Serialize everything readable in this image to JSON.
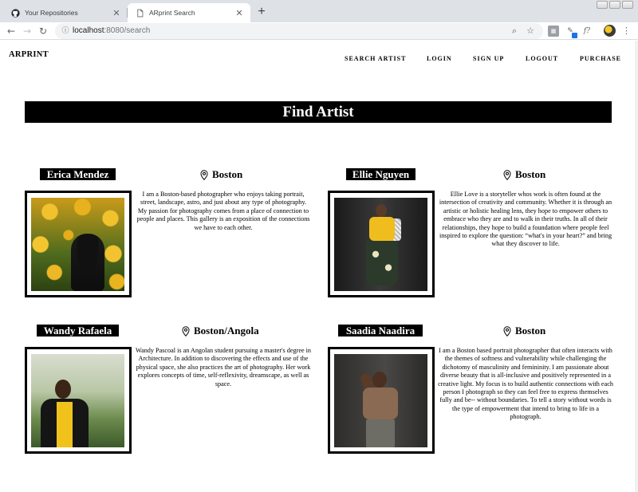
{
  "browser": {
    "tabs": [
      {
        "title": "Your Repositories",
        "active": false,
        "icon": "github-icon"
      },
      {
        "title": "ARprint Search",
        "active": true,
        "icon": "page-icon"
      }
    ],
    "url_host": "localhost",
    "url_path": ":8080/search"
  },
  "site": {
    "brand": "ARPRINT",
    "nav": [
      "SEARCH ARTIST",
      "LOGIN",
      "SIGN UP",
      "LOGOUT",
      "PURCHASE"
    ]
  },
  "page": {
    "title": "Find Artist"
  },
  "artists": [
    {
      "name": "Erica Mendez",
      "location": "Boston",
      "bio": "I am a Boston-based photographer who enjoys taking portrait, street, landscape, astro, and just about any type of photography. My passion for photography comes from a place of connection to people and places. This gallery is an exposition of the connections we have to each other."
    },
    {
      "name": "Ellie Nguyen",
      "location": "Boston",
      "bio": "Ellie Love is a storyteller whos work is often found at the intersection of creativity and community. Whether it is through an artistic or holistic healing lens, they hope to empower others to embrace who they are and to walk in their truths. In all of their relationships, they hope to build a foundation where people feel inspired to explore the question: “what's in your heart?” and bring what they discover to life."
    },
    {
      "name": "Wandy Rafaela",
      "location": "Boston/Angola",
      "bio": "Wandy Pascoal is an Angolan student pursuing a master's degree in Architecture. In addition to discovering the effects and use of the physical space, she also practices the art of photography. Her work explores concepts of time, self-reflexivity, dreamscape, as well as space."
    },
    {
      "name": "Saadia Naadira",
      "location": "Boston",
      "bio": "I am a Boston based portrait photographer that often interacts with the themes of softness and vulnerability while challenging the dichotomy of masculinity and femininity. I am passionate about diverse beauty that is all-inclusive and positively represented in a creative light. My focus is to build authentic connections with each person I photograph so they can feel free to express themselves fully and be-- without boundaries. To tell a story without words is the type of empowerment that intend to bring to life in a photograph."
    }
  ]
}
